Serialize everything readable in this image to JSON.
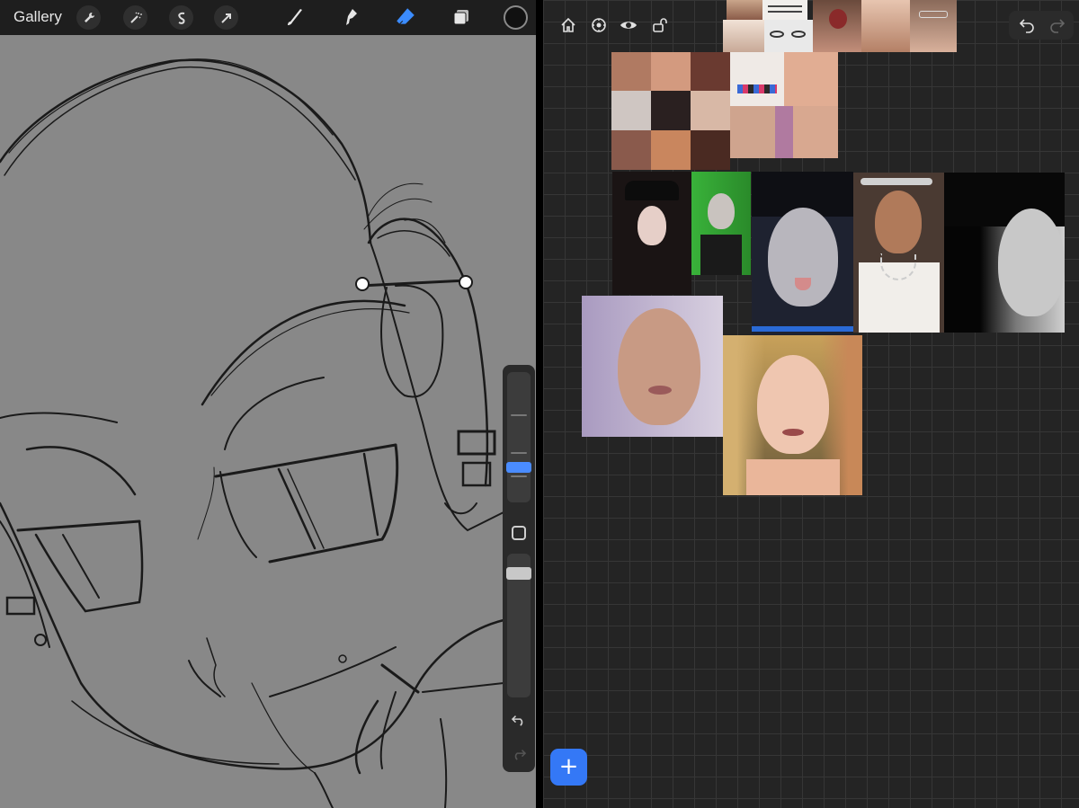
{
  "procreate": {
    "gallery_label": "Gallery",
    "tools": [
      "wrench-icon",
      "magic-wand-icon",
      "selection-icon",
      "transform-arrow-icon"
    ],
    "brush_tools": [
      "brush-icon",
      "smudge-icon",
      "eraser-icon",
      "layers-icon"
    ],
    "active_tool": "eraser-icon",
    "current_color": "#111111",
    "canvas_color": "#888888"
  },
  "freeform": {
    "add_label": "+",
    "toolbar_icons": [
      "home-icon",
      "settings-icon",
      "eye-icon",
      "unlock-icon"
    ],
    "images": [
      {
        "name": "ref-face-lips"
      },
      {
        "name": "ref-eyes-diagram"
      },
      {
        "name": "ref-tongue-open-mouth"
      },
      {
        "name": "ref-smiling-woman"
      },
      {
        "name": "ref-glasses-tongue"
      },
      {
        "name": "ref-blonde-woman-small"
      },
      {
        "name": "ref-ear-piercings-grid"
      },
      {
        "name": "ref-belly-piercings-grid"
      },
      {
        "name": "ref-goth-hat-woman"
      },
      {
        "name": "ref-green-hair-goth"
      },
      {
        "name": "ref-tongue-piercing-goth"
      },
      {
        "name": "ref-smiling-chain-necklace"
      },
      {
        "name": "ref-bw-profile-nose-ring"
      },
      {
        "name": "ref-lavender-hair-makeup"
      },
      {
        "name": "ref-strawberry-blonde-selfie"
      }
    ]
  }
}
